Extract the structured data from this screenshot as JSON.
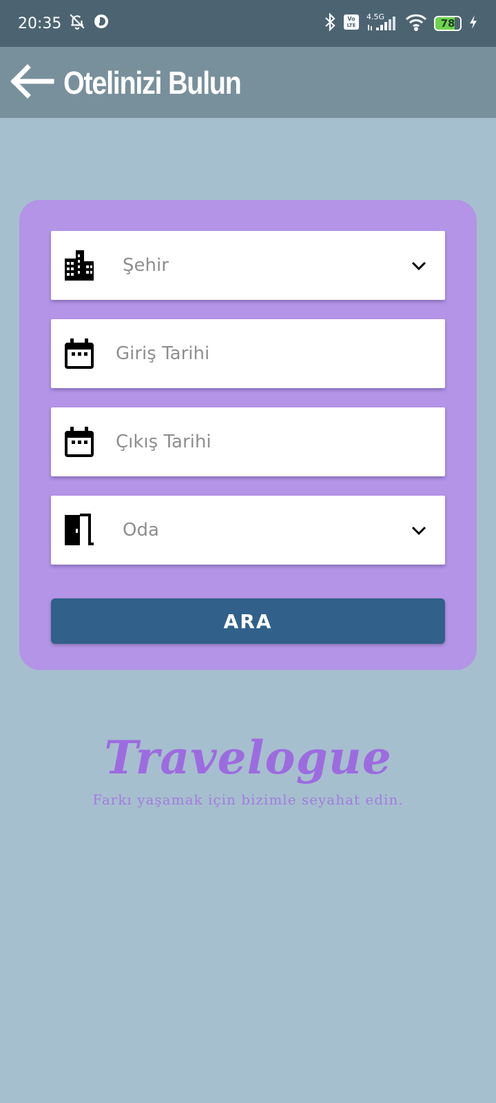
{
  "status_bar": {
    "time": "20:35",
    "network_label": "4.5G",
    "volte_label": "Vo LTE",
    "battery": "78",
    "icons": [
      "bell-off-icon",
      "app-notification-icon",
      "bluetooth-icon",
      "signal-icon",
      "wifi-icon",
      "battery-icon",
      "charging-icon"
    ]
  },
  "app_bar": {
    "title": "Otelinizi Bulun",
    "back_icon": "arrow-left-icon"
  },
  "form": {
    "city": {
      "placeholder": "Şehir",
      "icon": "city-icon"
    },
    "check_in": {
      "placeholder": "Giriş Tarihi",
      "icon": "calendar-icon"
    },
    "check_out": {
      "placeholder": "Çıkış Tarihi",
      "icon": "calendar-icon"
    },
    "room": {
      "placeholder": "Oda",
      "icon": "door-icon"
    },
    "search_label": "ARA"
  },
  "brand": {
    "name": "Travelogue",
    "tagline": "Farkı yaşamak için bizimle seyahat edin."
  },
  "colors": {
    "background": "#a6bfce",
    "status_bar": "#4c6472",
    "app_bar": "#78909c",
    "card": "#b394e6",
    "button": "#31608a",
    "brand": "#9d6be0"
  }
}
